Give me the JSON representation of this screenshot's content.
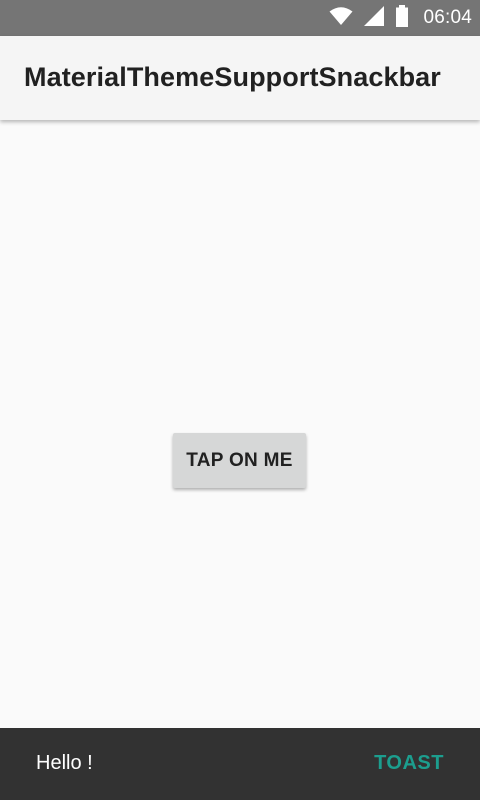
{
  "status_bar": {
    "time": "06:04",
    "icons": [
      "wifi-icon",
      "cellular-signal-icon",
      "battery-icon"
    ]
  },
  "app_bar": {
    "title": "MaterialThemeSupportSnackbar"
  },
  "main": {
    "button_label": "TAP ON ME"
  },
  "snackbar": {
    "message": "Hello !",
    "action_label": "TOAST"
  },
  "colors": {
    "status_bar": "#757575",
    "app_bar": "#f5f5f5",
    "background": "#fafafa",
    "button": "#d6d7d7",
    "snackbar": "#323232",
    "snackbar_action": "#1c9e8e"
  }
}
